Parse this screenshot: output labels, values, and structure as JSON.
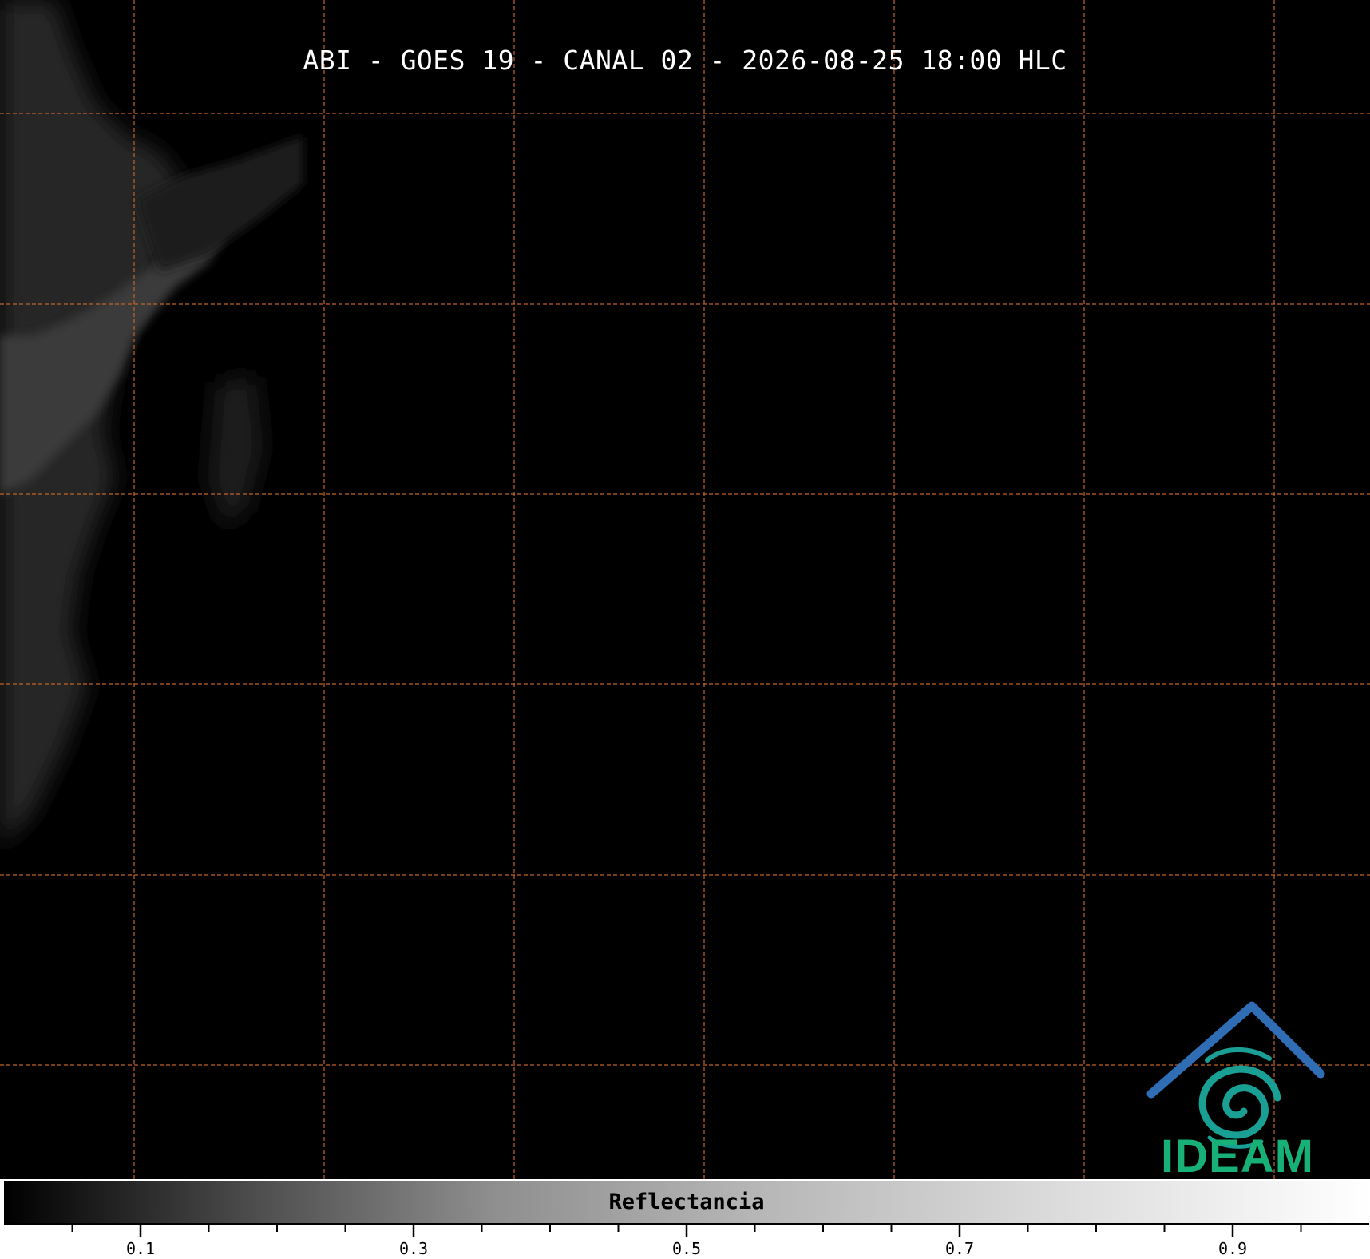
{
  "map": {
    "title": "ABI - GOES 19 - CANAL 02 - 2026-08-25 18:00 HLC",
    "background_color": "#000000",
    "gridline_color": "#c0632a",
    "gridline_style": "dashed",
    "gridline_count_vertical": 7,
    "gridline_count_horizontal": 6,
    "cloud_region": "left edge, faint grey cloud band"
  },
  "logo": {
    "icon": "ideam-house-spiral-icon",
    "text": "IDEAM",
    "text_color": "#17b178",
    "roof_color": "#2f6db5",
    "spiral_color": "#1a9f95"
  },
  "colorbar": {
    "label": "Reflectancia",
    "vmin": 0,
    "vmax": 1,
    "major_ticks": [
      0.1,
      0.3,
      0.5,
      0.7,
      0.9
    ],
    "minor_ticks": [
      0.05,
      0.15,
      0.2,
      0.25,
      0.35,
      0.4,
      0.45,
      0.55,
      0.6,
      0.65,
      0.75,
      0.8,
      0.85,
      0.95
    ],
    "tick_labels": [
      "0.1",
      "0.3",
      "0.5",
      "0.7",
      "0.9"
    ],
    "cmap": "greys (black to white)"
  }
}
